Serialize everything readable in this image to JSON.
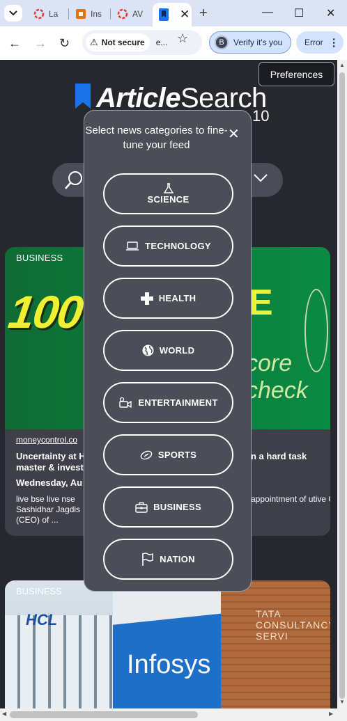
{
  "browser": {
    "tabs": [
      {
        "label": "La",
        "favicon": "loading-ring-icon",
        "color": "#e53935"
      },
      {
        "label": "Ins",
        "favicon": "orange-square-icon",
        "color": "#e8710a"
      },
      {
        "label": "AV",
        "favicon": "loading-ring-icon",
        "color": "#e53935"
      }
    ],
    "active_tab": {
      "favicon": "blue-bookmark-icon",
      "close": "✕"
    },
    "new_tab": "+",
    "window_controls": {
      "minimize": "—",
      "maximize": "☐",
      "close": "✕"
    },
    "address": {
      "security_label": "Not secure",
      "url": "e...",
      "verify_label": "Verify it's you",
      "verify_avatar": "B",
      "error_label": "Error"
    }
  },
  "header": {
    "preferences_label": "Preferences",
    "logo_bold": "Article",
    "logo_light": "Search",
    "logo_suffix": "10"
  },
  "modal": {
    "title": "Select news categories to fine-tune your feed",
    "close": "✕",
    "categories": [
      {
        "label": "SCIENCE",
        "icon": "flask-icon"
      },
      {
        "label": "TECHNOLOGY",
        "icon": "laptop-icon"
      },
      {
        "label": "HEALTH",
        "icon": "medical-cross-icon"
      },
      {
        "label": "WORLD",
        "icon": "globe-icon"
      },
      {
        "label": "ENTERTAINMENT",
        "icon": "video-camera-icon"
      },
      {
        "label": "SPORTS",
        "icon": "football-icon"
      },
      {
        "label": "BUSINESS",
        "icon": "briefcase-icon"
      },
      {
        "label": "NATION",
        "icon": "flag-icon"
      }
    ]
  },
  "cards": [
    {
      "tag": "BUSINESS",
      "image_text_left": "100 CAS",
      "image_text_right": "E",
      "image_text_right2": "core check",
      "source": "moneycontrol.co",
      "title_left": "Uncertainty at H master & invest",
      "title_right": "n a hard task",
      "date": "Wednesday, Au",
      "desc_left": "live bse live nse Sashidhar Jagdis (CEO) of ...",
      "desc_right": "appointment of utive Officer"
    },
    {
      "tag": "BUSINESS",
      "image_text_hcl": "HCL",
      "image_text_infosys": "Infosys",
      "image_text_tata": "TATA CONSULTANCY SERVI"
    }
  ]
}
